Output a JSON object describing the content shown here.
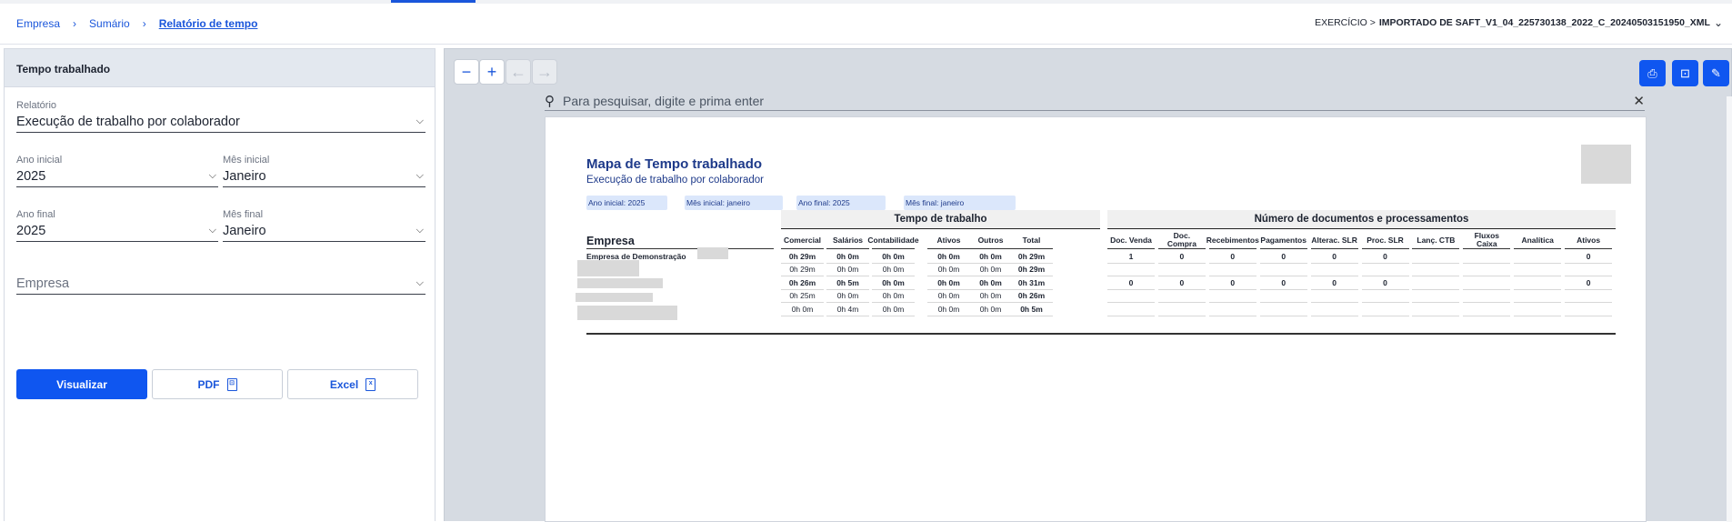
{
  "breadcrumbs": [
    "Empresa",
    "Sumário",
    "Relatório de tempo"
  ],
  "exercise": {
    "prefix": "EXERCÍCIO >",
    "value": "IMPORTADO DE SAFT_V1_04_225730138_2022_C_20240503151950_XML"
  },
  "panel": {
    "title": "Tempo trabalhado",
    "relatorio": {
      "label": "Relatório",
      "value": "Execução de trabalho por colaborador"
    },
    "ano_inicial": {
      "label": "Ano inicial",
      "value": "2025"
    },
    "mes_inicial": {
      "label": "Mês inicial",
      "value": "Janeiro"
    },
    "ano_final": {
      "label": "Ano final",
      "value": "2025"
    },
    "mes_final": {
      "label": "Mês final",
      "value": "Janeiro"
    },
    "empresa": {
      "placeholder": "Empresa"
    },
    "buttons": {
      "visualizar": "Visualizar",
      "pdf": "PDF",
      "excel": "Excel"
    }
  },
  "viewer": {
    "search_placeholder": "Para pesquisar, digite e prima enter",
    "toolbar_icons": [
      "zoom-out-icon",
      "zoom-in-icon",
      "arrow-left-icon",
      "arrow-right-icon",
      "print-icon",
      "pdf-icon",
      "edit-icon"
    ]
  },
  "report": {
    "title": "Mapa de Tempo trabalhado",
    "subtitle": "Execução de trabalho por colaborador",
    "filters": [
      "Ano inicial: 2025",
      "Mês inicial: janeiro",
      "Ano final: 2025",
      "Mês final: janeiro"
    ],
    "group_time": "Tempo de trabalho",
    "group_docs": "Número de documentos e processamentos",
    "empresa_header": "Empresa",
    "time_columns": [
      "Comercial",
      "Salários",
      "Contabilidade",
      "Ativos",
      "Outros",
      "Total"
    ],
    "doc_columns": [
      "Doc. Venda",
      "Doc. Compra",
      "Recebimentos",
      "Pagamentos",
      "Alterac. SLR",
      "Proc. SLR",
      "Lanç. CTB",
      "Fluxos Caixa",
      "Analítica",
      "Ativos"
    ],
    "rows": [
      {
        "name": "Empresa de Demonstração",
        "bold": true,
        "time": [
          "0h 29m",
          "0h 0m",
          "0h 0m",
          "0h 0m",
          "0h 0m",
          "0h 29m"
        ],
        "docs": [
          "1",
          "0",
          "0",
          "0",
          "0",
          "0",
          "",
          "",
          "",
          "0"
        ]
      },
      {
        "name": "",
        "bold": false,
        "time": [
          "0h 29m",
          "0h 0m",
          "0h 0m",
          "0h 0m",
          "0h 0m",
          "0h 29m"
        ],
        "docs": [
          "",
          "",
          "",
          "",
          "",
          "",
          "",
          "",
          "",
          ""
        ]
      },
      {
        "name": "",
        "bold": true,
        "time": [
          "0h 26m",
          "0h 5m",
          "0h 0m",
          "0h 0m",
          "0h 0m",
          "0h 31m"
        ],
        "docs": [
          "0",
          "0",
          "0",
          "0",
          "0",
          "0",
          "",
          "",
          "",
          "0"
        ]
      },
      {
        "name": "",
        "bold": false,
        "time": [
          "0h 25m",
          "0h 0m",
          "0h 0m",
          "0h 0m",
          "0h 0m",
          "0h 26m"
        ],
        "docs": [
          "",
          "",
          "",
          "",
          "",
          "",
          "",
          "",
          "",
          ""
        ]
      },
      {
        "name": "",
        "bold": false,
        "time": [
          "0h 0m",
          "0h 4m",
          "0h 0m",
          "0h 0m",
          "0h 0m",
          "0h 5m"
        ],
        "docs": [
          "",
          "",
          "",
          "",
          "",
          "",
          "",
          "",
          "",
          ""
        ]
      }
    ]
  }
}
